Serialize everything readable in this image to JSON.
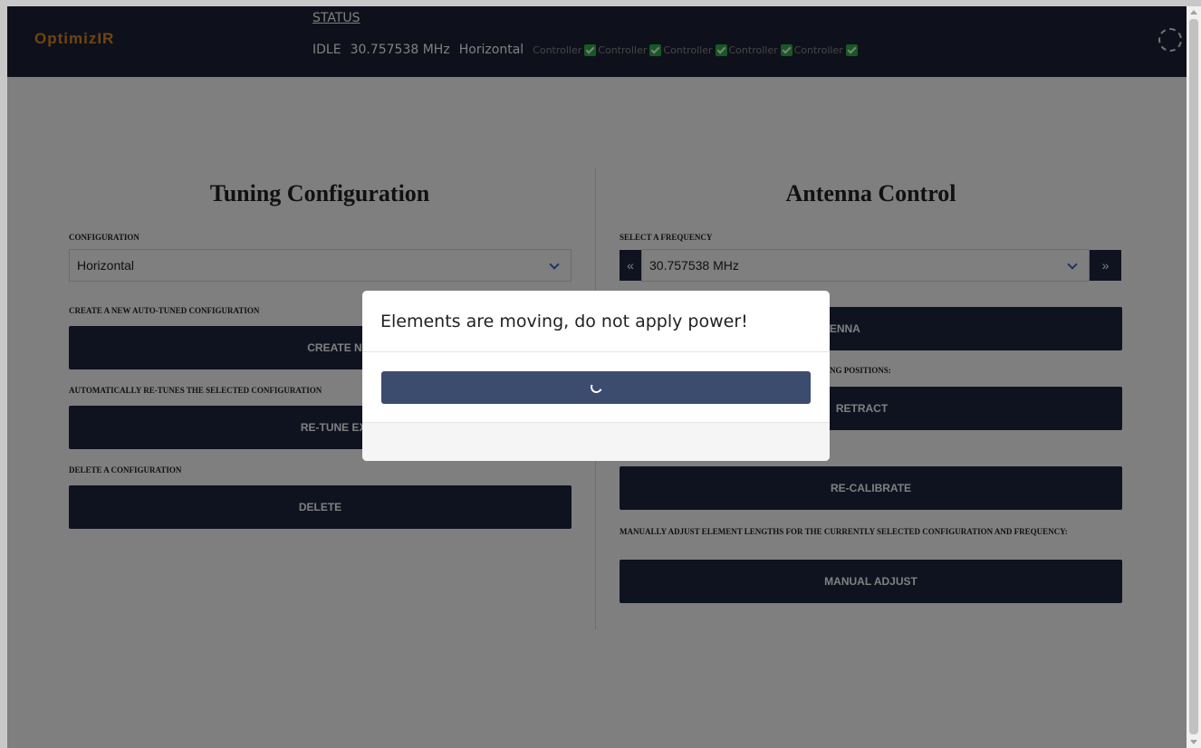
{
  "header": {
    "logo": "OptimizIR",
    "status_link": "STATUS",
    "state": "IDLE",
    "frequency": "30.757538 MHz",
    "configuration": "Horizontal",
    "sensors": [
      {
        "label": "Controller"
      },
      {
        "label": "Controller"
      },
      {
        "label": "Controller"
      },
      {
        "label": "Controller"
      },
      {
        "label": "Controller"
      }
    ]
  },
  "tuning": {
    "title": "Tuning Configuration",
    "config_label": "CONFIGURATION",
    "config_value": "Horizontal",
    "create_label": "CREATE A NEW AUTO-TUNED CONFIGURATION",
    "create_button": "CREATE NEW CONFIGU",
    "retune_label": "AUTOMATICALLY RE-TUNES THE SELECTED CONFIGURATION",
    "retune_button": "RE-TUNE EXISTING CONFI",
    "delete_label": "DELETE A CONFIGURATION",
    "delete_button": "DELETE"
  },
  "antenna": {
    "title": "Antenna Control",
    "freq_label": "SELECT A FREQUENCY",
    "freq_value": "30.757538 MHz",
    "prev_label": "«",
    "next_label": "»",
    "send_button": "END TO ANTENNA",
    "positions_label": "NG POSITIONS:",
    "retract_button": "RETRACT",
    "recalibrate_button": "RE-CALIBRATE",
    "manual_label": "MANUALLY ADJUST ELEMENT LENGTHS FOR THE CURRENTLY SELECTED CONFIGURATION AND FREQUENCY:",
    "manual_button": "MANUAL ADJUST"
  },
  "modal": {
    "title": "Elements are moving, do not apply power!"
  },
  "colors": {
    "header_bg": "#1d2336",
    "logo": "#e08a1e",
    "button_bg": "#1f2740",
    "progress_bg": "#3b4c6e",
    "check": "#2fb344"
  }
}
